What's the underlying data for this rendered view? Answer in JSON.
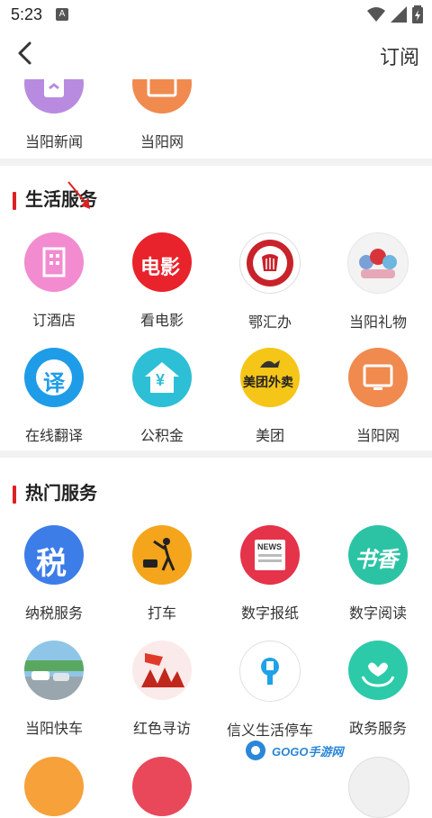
{
  "status": {
    "time": "5:23",
    "notif_glyph": "A"
  },
  "header": {
    "subscribe_label": "订阅"
  },
  "top_row": [
    {
      "label": "当阳新闻",
      "icon": "news-icon",
      "color": "#b98be0"
    },
    {
      "label": "当阳网",
      "icon": "monitor-icon",
      "color": "#f08a4e"
    }
  ],
  "life": {
    "title": "生活服务",
    "items": [
      {
        "label": "订酒店",
        "icon": "hotel-icon",
        "color": "#f38bd0"
      },
      {
        "label": "看电影",
        "icon": "movie-icon",
        "color": "#e8232b",
        "glyph": "电影"
      },
      {
        "label": "鄂汇办",
        "icon": "ehuiban-logo-icon",
        "color": "#c8222b"
      },
      {
        "label": "当阳礼物",
        "icon": "gift-mascot-icon",
        "color": "#f3f3f3"
      },
      {
        "label": "在线翻译",
        "icon": "translate-icon",
        "color": "#1f9ce8",
        "glyph": "译"
      },
      {
        "label": "公积金",
        "icon": "fund-icon",
        "color": "#2dbfd6",
        "glyph": "¥"
      },
      {
        "label": "美团",
        "icon": "meituan-icon",
        "color": "#f5c518",
        "glyph": "美团外卖"
      },
      {
        "label": "当阳网",
        "icon": "monitor-icon",
        "color": "#f08a4e"
      }
    ]
  },
  "hot": {
    "title": "热门服务",
    "items": [
      {
        "label": "纳税服务",
        "icon": "tax-icon",
        "color": "#3c7de8",
        "glyph": "税"
      },
      {
        "label": "打车",
        "icon": "taxi-icon",
        "color": "#f4a51c"
      },
      {
        "label": "数字报纸",
        "icon": "newspaper-icon",
        "color": "#e5334a",
        "glyph": "NEWS"
      },
      {
        "label": "数字阅读",
        "icon": "reading-icon",
        "color": "#2cc3a5",
        "glyph": "书香"
      },
      {
        "label": "当阳快车",
        "icon": "express-bus-icon",
        "color": "#8fc6e8"
      },
      {
        "label": "红色寻访",
        "icon": "red-tour-icon",
        "color": "#e03a2b"
      },
      {
        "label": "信义生活停车",
        "icon": "parking-icon",
        "color": "#ffffff"
      },
      {
        "label": "政务服务",
        "icon": "gov-service-icon",
        "color": "#2ccaa8"
      }
    ]
  },
  "watermark": "GOGO手游网"
}
